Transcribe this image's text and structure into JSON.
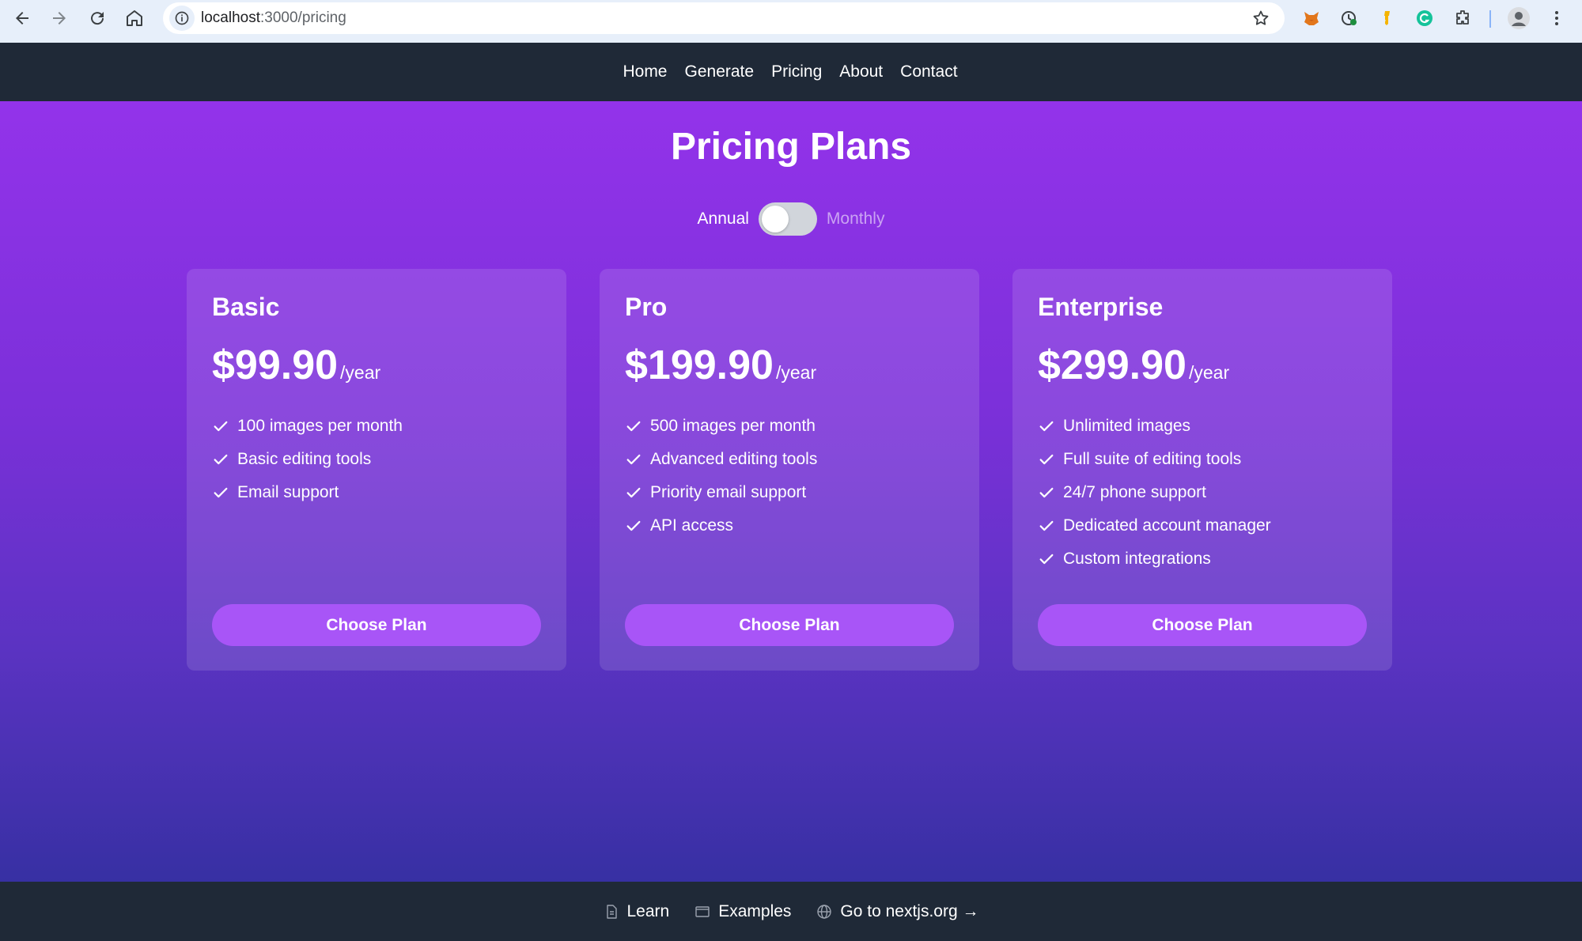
{
  "browser": {
    "url_host": "localhost",
    "url_path": ":3000/pricing"
  },
  "site_nav": {
    "items": [
      "Home",
      "Generate",
      "Pricing",
      "About",
      "Contact"
    ]
  },
  "page": {
    "title": "Pricing Plans"
  },
  "billing_toggle": {
    "left_label": "Annual",
    "right_label": "Monthly",
    "selected": "Annual"
  },
  "plans": [
    {
      "name": "Basic",
      "price": "$99.90",
      "period": "/year",
      "features": [
        "100 images per month",
        "Basic editing tools",
        "Email support"
      ],
      "cta": "Choose Plan"
    },
    {
      "name": "Pro",
      "price": "$199.90",
      "period": "/year",
      "features": [
        "500 images per month",
        "Advanced editing tools",
        "Priority email support",
        "API access"
      ],
      "cta": "Choose Plan"
    },
    {
      "name": "Enterprise",
      "price": "$299.90",
      "period": "/year",
      "features": [
        "Unlimited images",
        "Full suite of editing tools",
        "24/7 phone support",
        "Dedicated account manager",
        "Custom integrations"
      ],
      "cta": "Choose Plan"
    }
  ],
  "footer": {
    "learn": "Learn",
    "examples": "Examples",
    "nextjs": "Go to nextjs.org →"
  },
  "colors": {
    "header_bg": "#1f2937",
    "gradient_top": "#9333ea",
    "gradient_bottom": "#3730a3",
    "button": "#a855f7"
  },
  "icons": {
    "browser": [
      "back-icon",
      "forward-icon",
      "reload-icon",
      "home-icon",
      "site-info-icon",
      "bookmark-star-icon",
      "extension-fox-icon",
      "extension-clock-icon",
      "extension-key-icon",
      "extension-grammar-icon",
      "extensions-puzzle-icon",
      "profile-avatar-icon",
      "menu-kebab-icon"
    ],
    "feature": "check-icon",
    "footer": [
      "file-icon",
      "window-icon",
      "globe-icon"
    ]
  }
}
